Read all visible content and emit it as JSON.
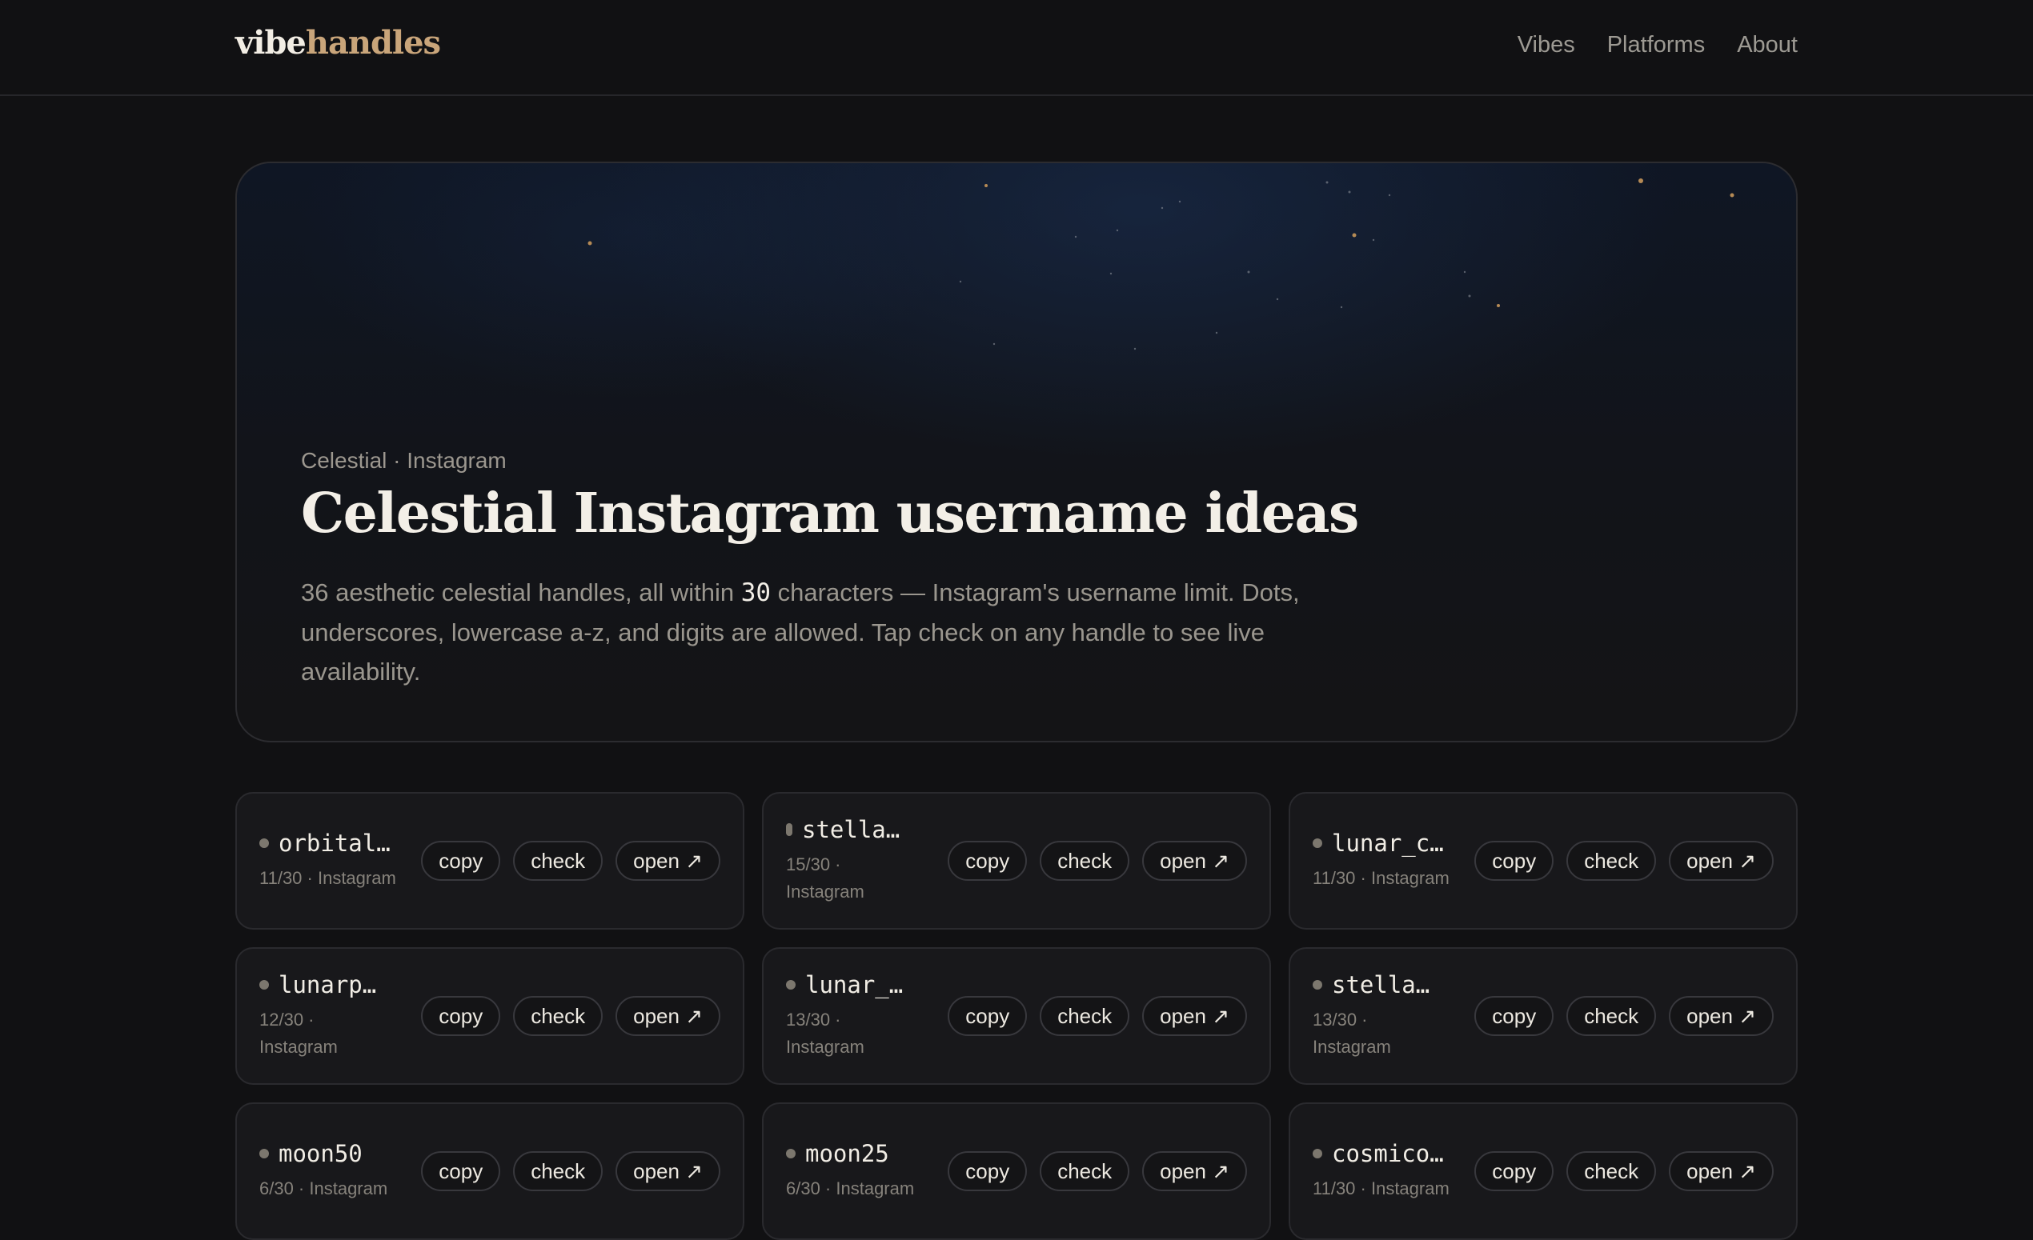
{
  "brand": {
    "part1": "vibe",
    "part2": "handles",
    "accent": "#c9a57a"
  },
  "nav": {
    "links": [
      "Vibes",
      "Platforms",
      "About"
    ]
  },
  "hero": {
    "kicker": "Celestial · Instagram",
    "title": "Celestial Instagram username ideas",
    "desc_before": "36 aesthetic celestial handles, all within ",
    "desc_num": "30",
    "desc_after": " characters — Instagram's username limit. Dots, underscores, lowercase a-z, and digits are allowed. Tap check on any handle to see live availability."
  },
  "buttons": {
    "copy": "copy",
    "check": "check",
    "open": "open ↗"
  },
  "cards": [
    {
      "handle": "orbital…",
      "meta": "11/30 · Instagram",
      "indicator": "dot"
    },
    {
      "handle": "stellar…",
      "meta": "15/30 · Instagram",
      "indicator": "bar"
    },
    {
      "handle": "lunar_c…",
      "meta": "11/30 · Instagram",
      "indicator": "dot"
    },
    {
      "handle": "lunarph…",
      "meta": "12/30 · Instagram",
      "indicator": "dot"
    },
    {
      "handle": "lunar_e…",
      "meta": "13/30 · Instagram",
      "indicator": "dot"
    },
    {
      "handle": "stellar…",
      "meta": "13/30 · Instagram",
      "indicator": "dot"
    },
    {
      "handle": "moon50",
      "meta": "6/30 · Instagram",
      "indicator": "dot"
    },
    {
      "handle": "moon25",
      "meta": "6/30 · Instagram",
      "indicator": "dot"
    },
    {
      "handle": "cosmico…",
      "meta": "11/30 · Instagram",
      "indicator": "dot"
    }
  ]
}
